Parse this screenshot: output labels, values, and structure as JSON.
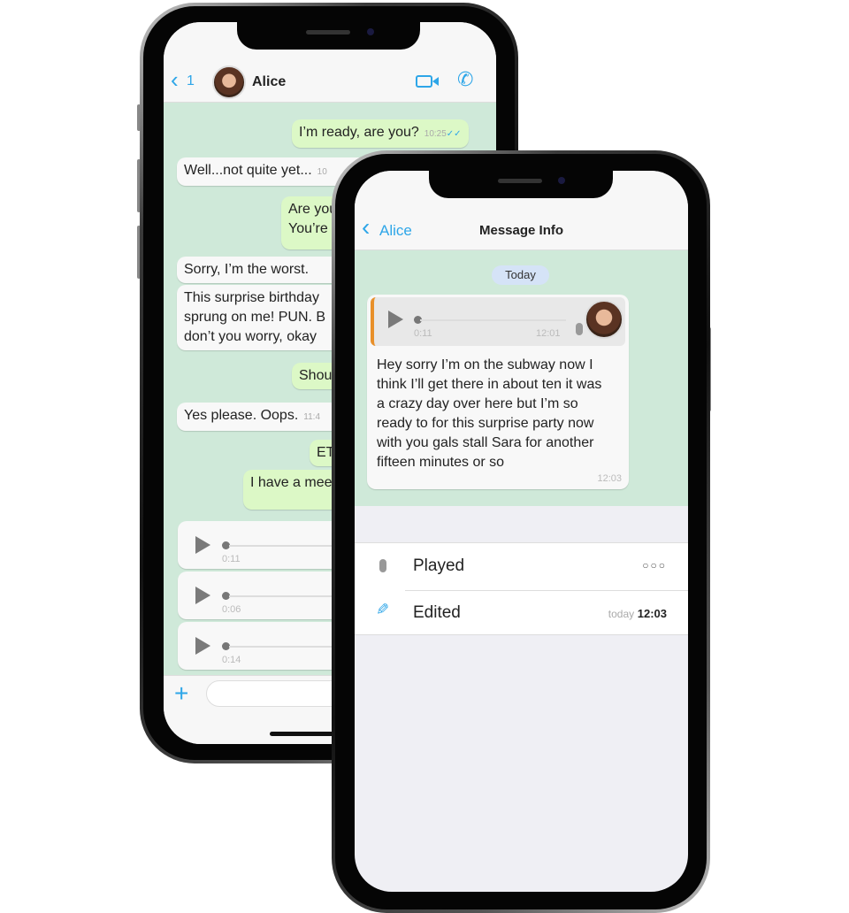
{
  "back_phone": {
    "header": {
      "back_count": "1",
      "contact_name": "Alice",
      "video_icon": "video-camera-icon",
      "call_icon": "phone-icon"
    },
    "messages": [
      {
        "dir": "out",
        "text": "I’m ready, are you?",
        "time": "10:25",
        "status": "read-double-check"
      },
      {
        "dir": "in",
        "text": "Well...not quite yet...",
        "time": "10"
      },
      {
        "dir": "out",
        "lines": [
          "Are you",
          "You’re"
        ]
      },
      {
        "dir": "in",
        "text": "Sorry, I’m the worst."
      },
      {
        "dir": "in",
        "lines": [
          "This surprise birthday",
          "sprung on me! PUN. B",
          "don’t you worry, okay"
        ]
      },
      {
        "dir": "out",
        "text": "Shou"
      },
      {
        "dir": "in",
        "text": "Yes please. Oops.",
        "time": "11:4"
      },
      {
        "dir": "out",
        "text": "ET"
      },
      {
        "dir": "out",
        "text": "I have a mee"
      }
    ],
    "voice_messages": [
      {
        "duration": "0:11"
      },
      {
        "duration": "0:06"
      },
      {
        "duration": "0:14"
      }
    ],
    "input": {
      "add_icon": "plus-icon",
      "placeholder": ""
    }
  },
  "front_phone": {
    "header": {
      "back_label": "Alice",
      "title": "Message Info"
    },
    "date_pill": "Today",
    "message": {
      "quoted_voice": {
        "duration": "0:11",
        "time": "12:01"
      },
      "lines": [
        "Hey sorry I’m on the subway now I",
        "think I’ll get there in about ten it was",
        "a crazy day over here but I’m so",
        "ready to for this surprise party now",
        "with you gals stall Sara for another",
        "fifteen minutes or so"
      ],
      "time": "12:03"
    },
    "info_rows": [
      {
        "icon": "microphone-icon",
        "label": "Played",
        "value": "○○○"
      },
      {
        "icon": "pencil-icon",
        "label": "Edited",
        "value_prefix": "today",
        "value": "12:03"
      }
    ]
  },
  "colors": {
    "accent": "#2ea6e8",
    "chat_bg": "#cfe9d9",
    "outgoing": "#dcf8c6",
    "incoming": "#f8f8f8",
    "quote_bar": "#e8902a",
    "date_pill": "#d5e3f7"
  }
}
